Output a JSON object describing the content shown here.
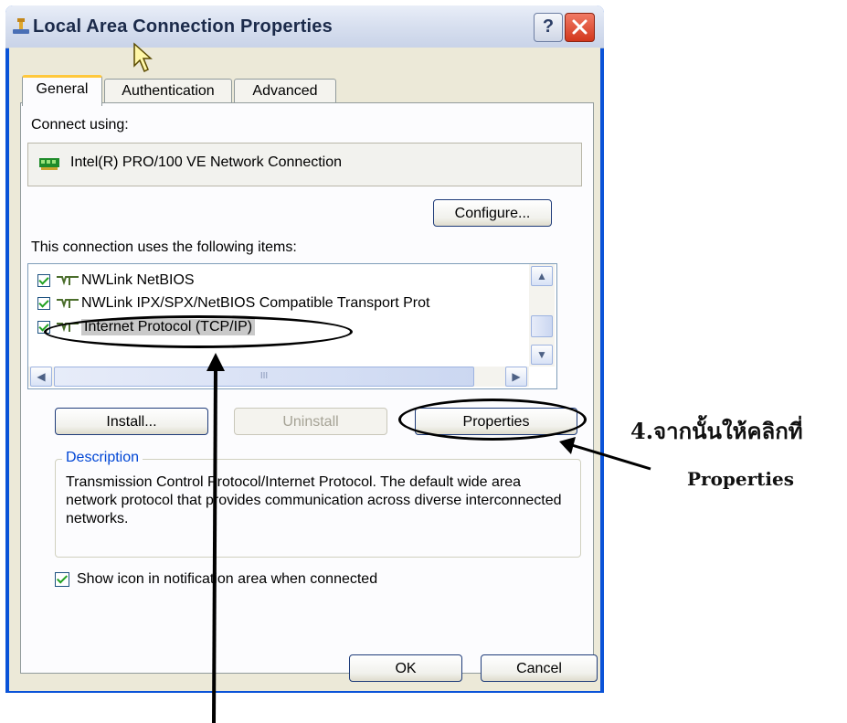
{
  "window": {
    "title": "Local Area Connection Properties",
    "help_label": "?"
  },
  "tabs": [
    {
      "label": "General",
      "active": true
    },
    {
      "label": "Authentication",
      "active": false
    },
    {
      "label": "Advanced",
      "active": false
    }
  ],
  "general": {
    "connect_using_label": "Connect using:",
    "adapter_name": "Intel(R) PRO/100 VE Network Connection",
    "configure_button": "Configure...",
    "items_label": "This connection uses the following items:",
    "items": [
      {
        "label": "NWLink NetBIOS",
        "checked": true,
        "selected": false
      },
      {
        "label": "NWLink IPX/SPX/NetBIOS Compatible Transport Prot",
        "checked": true,
        "selected": false
      },
      {
        "label": "Internet Protocol (TCP/IP)",
        "checked": true,
        "selected": true
      }
    ],
    "hscroll_grip": "III",
    "install_button": "Install...",
    "uninstall_button": "Uninstall",
    "properties_button": "Properties",
    "description_title": "Description",
    "description_text": "Transmission Control Protocol/Internet Protocol. The default wide area network protocol that provides communication across diverse interconnected networks.",
    "show_icon_label": "Show icon in notification area when connected",
    "show_icon_checked": true
  },
  "footer": {
    "ok_button": "OK",
    "cancel_button": "Cancel"
  },
  "annotations": {
    "instruction_line1": "4.จากนั้นให้คลิกที่",
    "instruction_line2": "Properties"
  },
  "colors": {
    "title_bar_blue": "#0a53d8",
    "tab_highlight": "#ffc83c",
    "checkmark_green": "#21a121",
    "group_title_blue": "#0046d5",
    "close_button_red": "#d3371c"
  }
}
